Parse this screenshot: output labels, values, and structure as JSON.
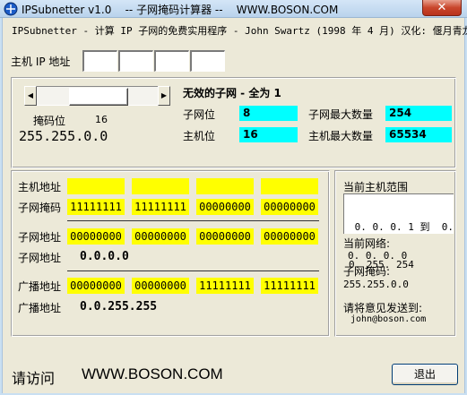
{
  "window": {
    "title": "IPSubnetter v1.0    -- 子网掩码计算器 --    WWW.BOSON.COM",
    "close_label": "✕"
  },
  "header": {
    "subtitle": "IPSubnetter - 计算 IP 子网的免费实用程序 - John Swartz (1998 年 4 月) 汉化: 偃月青龙"
  },
  "host_ip": {
    "label": "主机 IP 地址",
    "octets": [
      "",
      "",
      "",
      ""
    ]
  },
  "mask_group": {
    "mask_bits_label": "掩码位",
    "mask_bits_value": "16",
    "mask_bits_fraction": 0.5,
    "mask_value": "255.255.0.0",
    "invalid_subnet_text": "无效的子网 - 全为 1",
    "subnet_bits_label": "子网位",
    "subnet_bits_value": "8",
    "host_bits_label": "主机位",
    "host_bits_value": "16",
    "max_subnets_label": "子网最大数量",
    "max_subnets_value": "254",
    "max_hosts_label": "主机最大数量",
    "max_hosts_value": "65534"
  },
  "binary": {
    "host_addr_label": "主机地址",
    "host_addr_bits": [
      "",
      "",
      "",
      ""
    ],
    "subnet_mask_label": "子网掩码",
    "subnet_mask_bits": [
      "11111111",
      "11111111",
      "00000000",
      "00000000"
    ],
    "subnet_addr_label": "子网地址",
    "subnet_addr_bits": [
      "00000000",
      "00000000",
      "00000000",
      "00000000"
    ],
    "subnet_addr_text_label": "子网地址",
    "subnet_addr_value": "0.0.0.0",
    "broadcast_label": "广播地址",
    "broadcast_bits": [
      "00000000",
      "00000000",
      "11111111",
      "11111111"
    ],
    "broadcast_text_label": "广播地址",
    "broadcast_value": "0.0.255.255"
  },
  "side": {
    "host_range_label": "当前主机范围",
    "host_range_line1": " 0. 0. 0. 1 到  0.",
    "host_range_line2": "0. 255. 254",
    "network_label": "当前网络:",
    "network_value": "0. 0. 0. 0",
    "mask_label": "子网掩码:",
    "mask_value": "255.255.0.0",
    "feedback_label": "请将意见发送到:",
    "email": "john@boson.com"
  },
  "footer": {
    "visit_label": "请访问",
    "url": "WWW.BOSON.COM",
    "exit_label": "退出"
  },
  "colors": {
    "cyan": "#00ffff",
    "yellow": "#ffff00",
    "face": "#ece9d8"
  }
}
